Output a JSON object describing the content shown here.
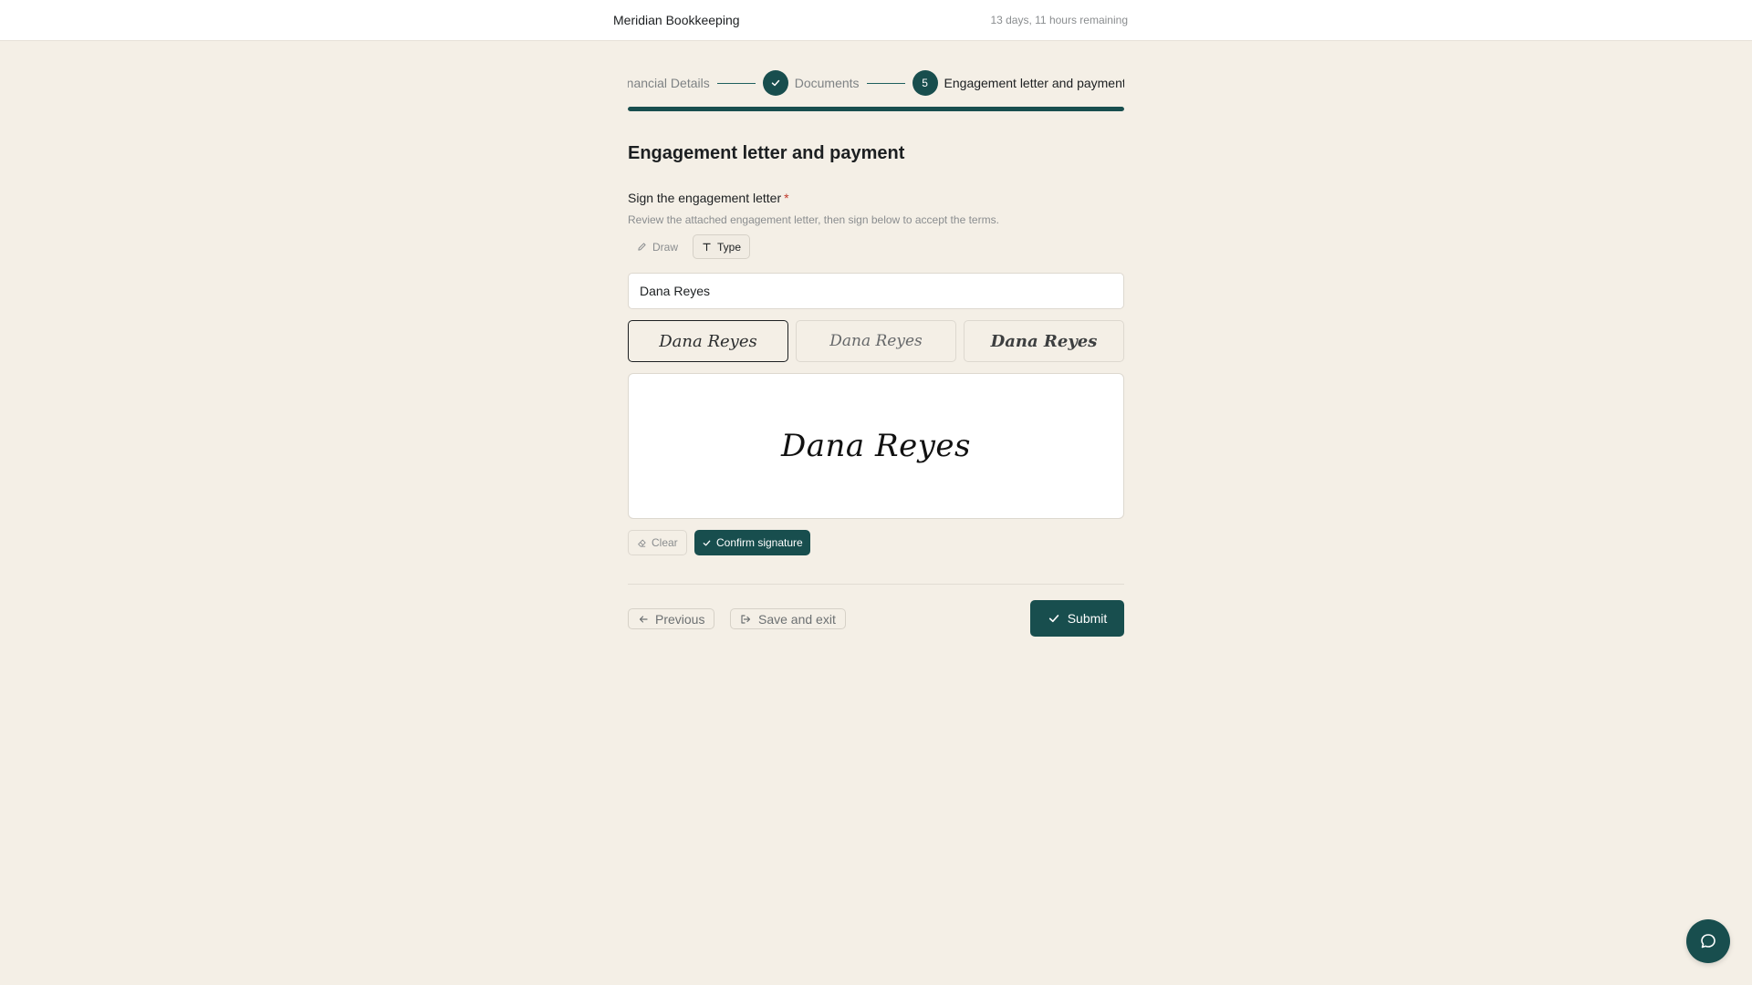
{
  "header": {
    "brand": "Meridian Bookkeeping",
    "time_remaining": "13 days, 11 hours remaining"
  },
  "stepper": {
    "steps": [
      {
        "label": "Financial Details",
        "state": "complete"
      },
      {
        "label": "Documents",
        "state": "complete"
      },
      {
        "label": "Engagement letter and payment",
        "state": "current",
        "number": "5"
      }
    ],
    "progress_fraction": 1.0
  },
  "form": {
    "title": "Engagement letter and payment",
    "signature_label": "Sign the engagement letter",
    "required_mark": "*",
    "help_text": "Review the attached engagement letter, then sign below to accept the terms.",
    "modes": {
      "draw": "Draw",
      "type": "Type",
      "selected": "type"
    },
    "name_value": "Dana Reyes",
    "style_options": [
      "Dana Reyes",
      "Dana Reyes",
      "Dana Reyes"
    ],
    "selected_style_index": 0,
    "signature_preview": "Dana Reyes",
    "clear_label": "Clear",
    "confirm_label": "Confirm signature"
  },
  "footer_nav": {
    "previous": "Previous",
    "save_exit": "Save and exit",
    "submit": "Submit"
  },
  "colors": {
    "accent": "#184e4e",
    "background": "#f4efe6",
    "required": "#c0392b"
  }
}
